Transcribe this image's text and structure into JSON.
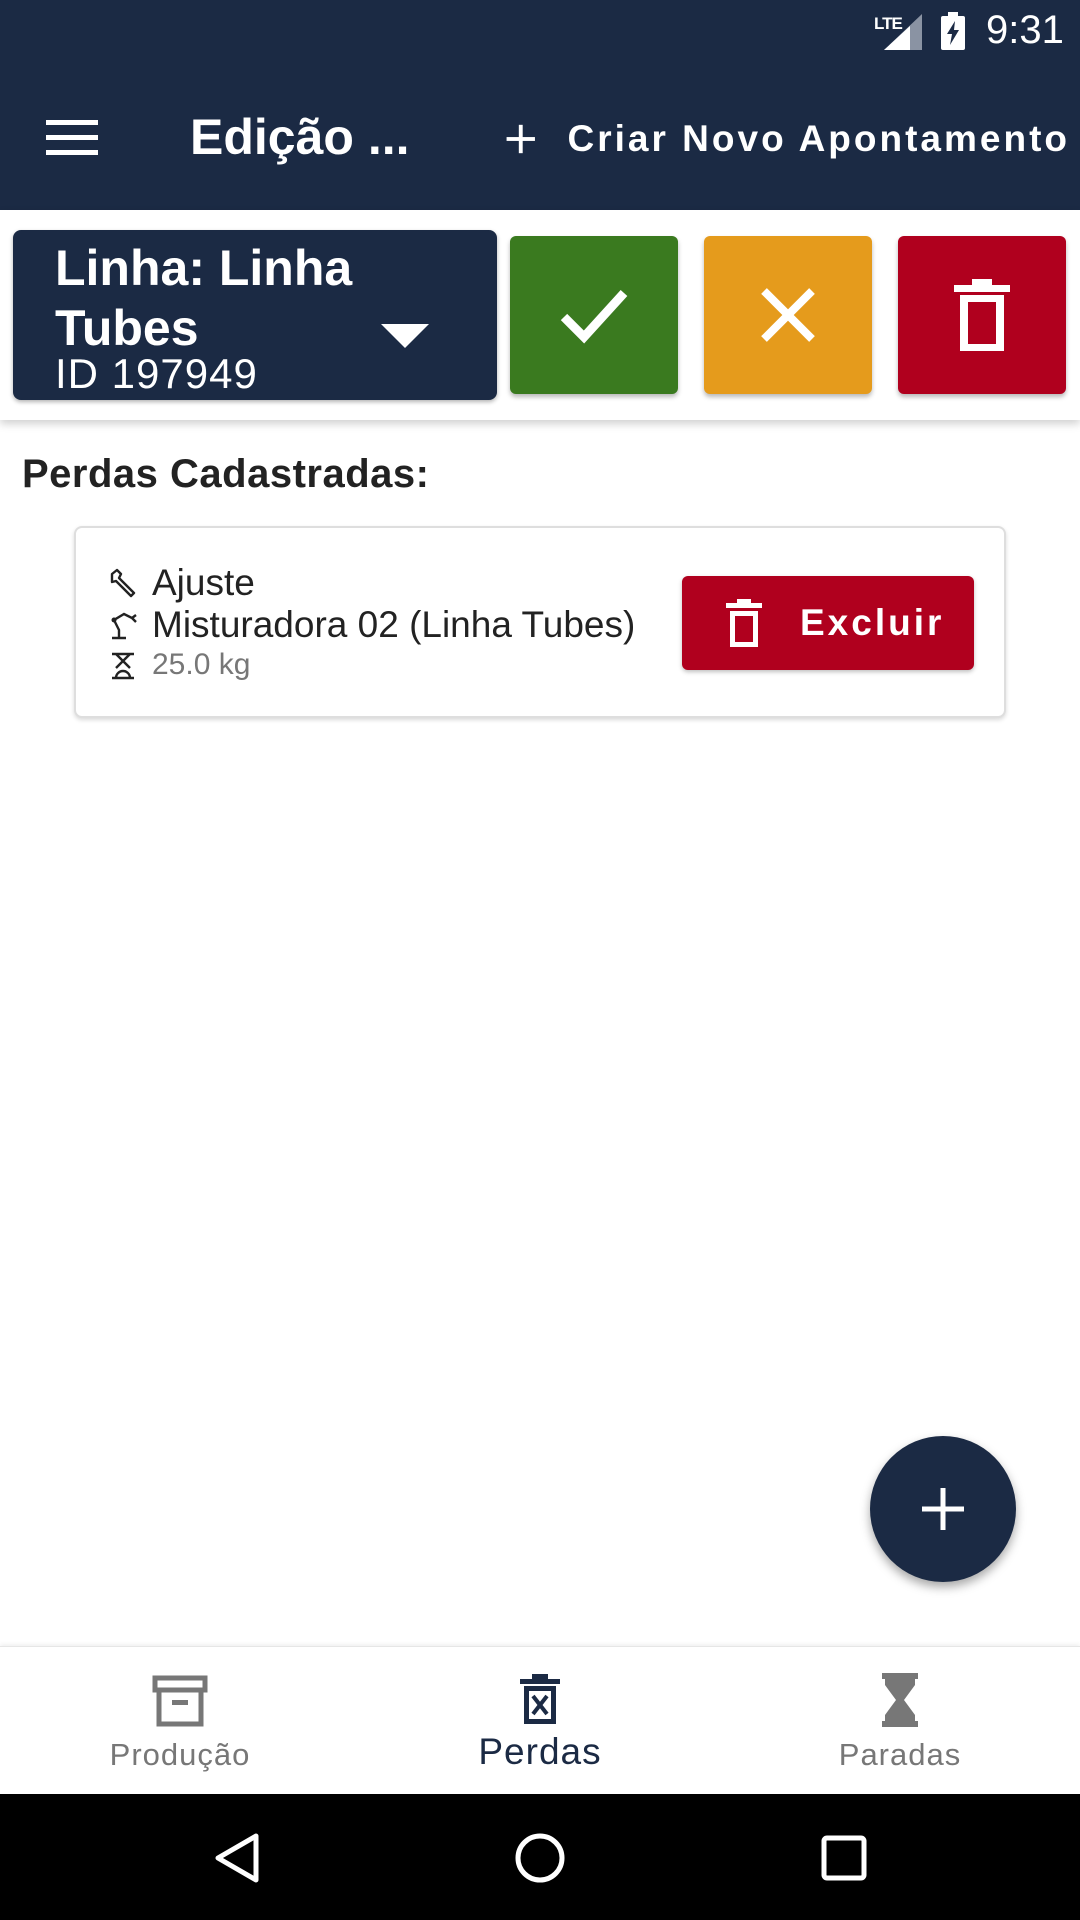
{
  "status_bar": {
    "network": "LTE",
    "time": "9:31"
  },
  "app_bar": {
    "title": "Edição ...",
    "new_entry_label": "Criar Novo Apontamento"
  },
  "toolbar": {
    "line_label": "Linha: Linha Tubes",
    "line_id": "ID 197949",
    "colors": {
      "confirm": "#3a7a1f",
      "cancel": "#e59b1c",
      "delete": "#b0001e"
    }
  },
  "content": {
    "section_title": "Perdas Cadastradas:",
    "losses": [
      {
        "type": "Ajuste",
        "machine": "Misturadora 02 (Linha Tubes)",
        "weight": "25.0 kg",
        "delete_label": "Excluir"
      }
    ]
  },
  "bottom_nav": {
    "items": [
      {
        "label": "Produção",
        "icon": "archive-icon",
        "active": false
      },
      {
        "label": "Perdas",
        "icon": "trash-x-icon",
        "active": true
      },
      {
        "label": "Paradas",
        "icon": "hourglass-icon",
        "active": false
      }
    ]
  },
  "theme": {
    "primary": "#1b2a44",
    "danger": "#b0001e"
  }
}
